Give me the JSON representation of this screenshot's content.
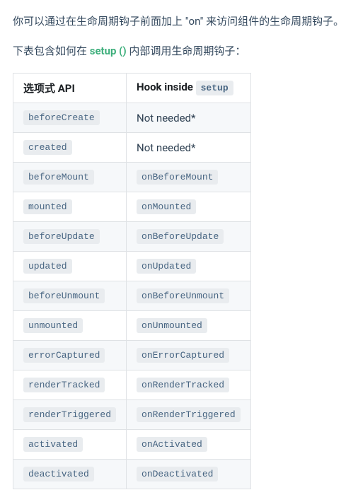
{
  "intro": "你可以通过在生命周期钩子前面加上 \"on\" 来访问组件的生命周期钩子。",
  "sub_prefix": "下表包含如何在 ",
  "sub_link": "setup ()",
  "sub_suffix": " 内部调用生命周期钩子：",
  "table": {
    "header": {
      "col1": "选项式 API",
      "col2_prefix": "Hook inside ",
      "col2_code": "setup"
    },
    "rows": [
      {
        "api": "beforeCreate",
        "hook_plain": "Not needed*"
      },
      {
        "api": "created",
        "hook_plain": "Not needed*"
      },
      {
        "api": "beforeMount",
        "hook_code": "onBeforeMount"
      },
      {
        "api": "mounted",
        "hook_code": "onMounted"
      },
      {
        "api": "beforeUpdate",
        "hook_code": "onBeforeUpdate"
      },
      {
        "api": "updated",
        "hook_code": "onUpdated"
      },
      {
        "api": "beforeUnmount",
        "hook_code": "onBeforeUnmount"
      },
      {
        "api": "unmounted",
        "hook_code": "onUnmounted"
      },
      {
        "api": "errorCaptured",
        "hook_code": "onErrorCaptured"
      },
      {
        "api": "renderTracked",
        "hook_code": "onRenderTracked"
      },
      {
        "api": "renderTriggered",
        "hook_code": "onRenderTriggered"
      },
      {
        "api": "activated",
        "hook_code": "onActivated"
      },
      {
        "api": "deactivated",
        "hook_code": "onDeactivated"
      }
    ]
  }
}
